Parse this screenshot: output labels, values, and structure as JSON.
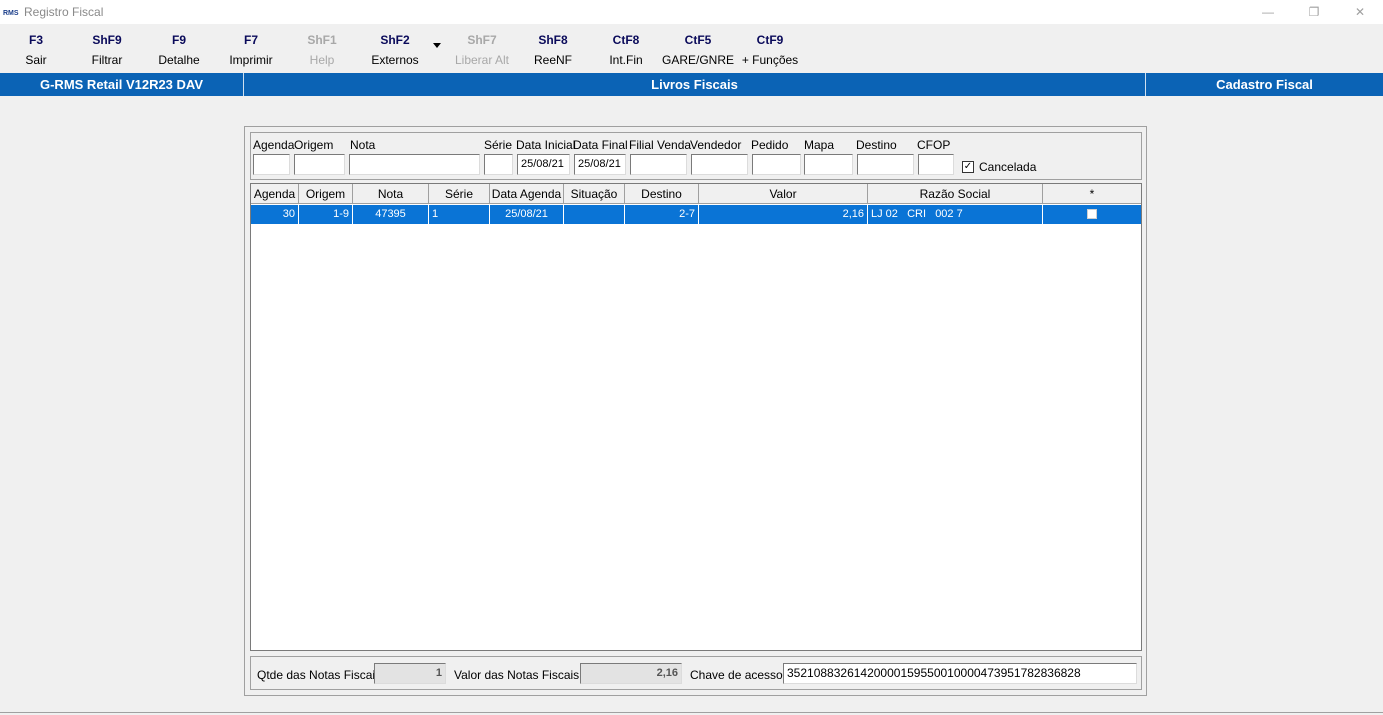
{
  "window": {
    "title": "Registro Fiscal",
    "controls": {
      "minimize": "—",
      "restore": "❐",
      "close": "✕"
    }
  },
  "toolbar": {
    "items": [
      {
        "key": "F3",
        "label": "Sair",
        "enabled": true
      },
      {
        "key": "ShF9",
        "label": "Filtrar",
        "enabled": true
      },
      {
        "key": "F9",
        "label": "Detalhe",
        "enabled": true
      },
      {
        "key": "F7",
        "label": "Imprimir",
        "enabled": true
      },
      {
        "key": "ShF1",
        "label": "Help",
        "enabled": false
      },
      {
        "key": "ShF2",
        "label": "Externos",
        "enabled": true
      },
      {
        "key": "ShF7",
        "label": "Liberar Alt",
        "enabled": false
      },
      {
        "key": "ShF8",
        "label": "ReeNF",
        "enabled": true
      },
      {
        "key": "CtF8",
        "label": "Int.Fin",
        "enabled": true
      },
      {
        "key": "CtF5",
        "label": "GARE/GNRE",
        "enabled": true
      },
      {
        "key": "CtF9",
        "label": "+ Funções",
        "enabled": true
      }
    ]
  },
  "header": {
    "left": "G-RMS Retail V12R23 DAV",
    "center": "Livros Fiscais",
    "right": "Cadastro Fiscal",
    "color": "#0b63b5"
  },
  "filters": {
    "labels": {
      "agenda": "Agenda",
      "origem": "Origem",
      "nota": "Nota",
      "serie": "Série",
      "data_inicial": "Data Inicial",
      "data_final": "Data Final",
      "filial_venda": "Filial Venda",
      "vendedor": "Vendedor",
      "pedido": "Pedido",
      "mapa": "Mapa",
      "destino": "Destino",
      "cfop": "CFOP",
      "cancelada": "Cancelada"
    },
    "values": {
      "agenda": "",
      "origem": "",
      "nota": "",
      "serie": "",
      "data_inicial": "25/08/21",
      "data_final": "25/08/21",
      "filial_venda": "",
      "vendedor": "",
      "pedido": "",
      "mapa": "",
      "destino": "",
      "cfop": "",
      "cancelada_checked": "✓"
    }
  },
  "grid": {
    "columns": [
      "Agenda",
      "Origem",
      "Nota",
      "Série",
      "Data Agenda",
      "Situação",
      "Destino",
      "Valor",
      "Razão Social",
      "*"
    ],
    "rows": [
      {
        "agenda": "30",
        "origem": "1-9",
        "nota": "47395",
        "serie": "1",
        "data_agenda": "25/08/21",
        "situacao": "",
        "destino": "2-7",
        "valor": "2,16",
        "razao_social": "LJ 02   CRI   002 7",
        "selected": true
      }
    ],
    "selection_color": "#0a74d6"
  },
  "footer": {
    "qtde_label": "Qtde das Notas Fiscais:",
    "qtde_value": "1",
    "valor_label": "Valor  das Notas Fiscais:",
    "valor_value": "2,16",
    "chave_label": "Chave de acesso:",
    "chave_value": "35210883261420000159550010000473951782836828"
  }
}
